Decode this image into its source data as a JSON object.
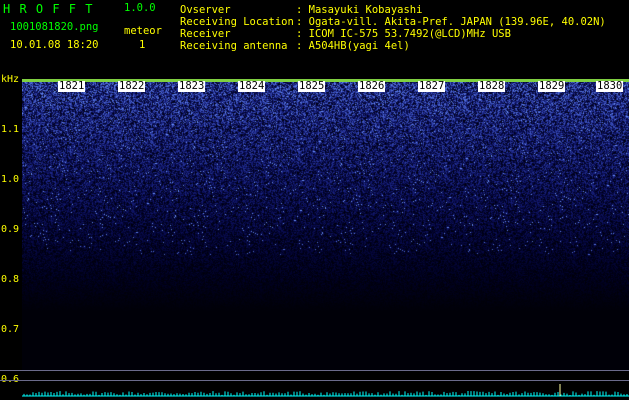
{
  "app": {
    "title": "H R O F F T",
    "version": "1.0.0"
  },
  "file": {
    "name": "1001081820.png",
    "datetime": "10.01.08 18:20"
  },
  "meteor": {
    "label": "meteor",
    "count": "1"
  },
  "station": {
    "rows": [
      {
        "label": "Ovserver",
        "value": ": Masayuki Kobayashi"
      },
      {
        "label": "Receiving Location",
        "value": ": Ogata-vill. Akita-Pref. JAPAN (139.96E, 40.02N)"
      },
      {
        "label": "Receiver",
        "value": ": ICOM IC-575 53.7492(@LCD)MHz USB"
      },
      {
        "label": "Receiving antenna",
        "value": ": A504HB(yagi 4el)"
      }
    ]
  },
  "yaxis": {
    "unit": "kHz",
    "ticks": [
      "1.1",
      "1.0",
      "0.9",
      "0.8",
      "0.7",
      "0.6"
    ]
  },
  "xaxis": {
    "times": [
      "1821",
      "1822",
      "1823",
      "1824",
      "1825",
      "1826",
      "1827",
      "1828",
      "1829",
      "1830"
    ]
  },
  "colors": {
    "header_title": "#00ff00",
    "header_text": "#ffff00",
    "axis_label": "#ffff00",
    "spectrum_dark": "#000010",
    "spectrum_bright": "#6a8aff",
    "baseline": "#00ffff"
  }
}
